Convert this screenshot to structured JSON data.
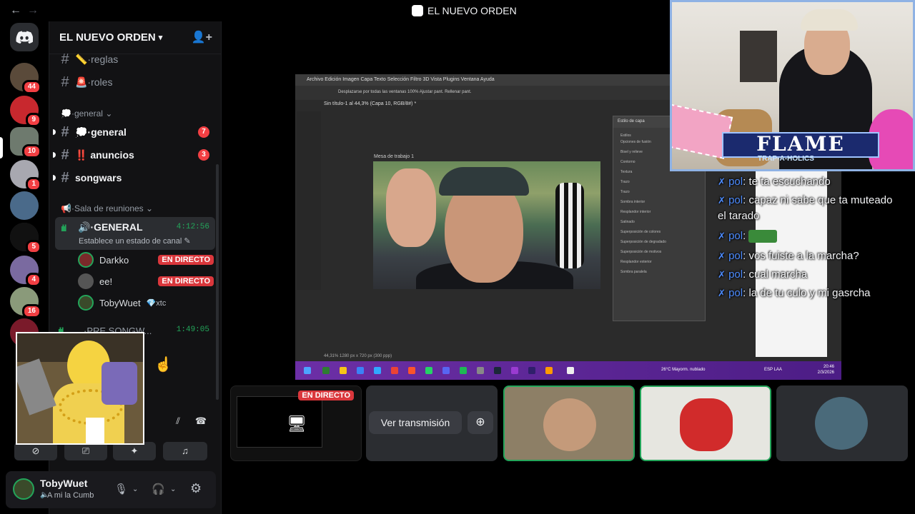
{
  "window": {
    "title": "EL NUEVO ORDEN"
  },
  "server": {
    "name": "EL NUEVO ORDEN"
  },
  "rail": {
    "badges": [
      "44",
      "9",
      "10",
      "1",
      "5",
      "4",
      "16"
    ]
  },
  "channels": {
    "top": [
      {
        "name": "📏·reglas"
      },
      {
        "name": "🚨·roles"
      }
    ],
    "general_category": "💭·general",
    "general": [
      {
        "name": "💭·general",
        "count": "7"
      },
      {
        "name": "‼️ anuncios",
        "count": "3"
      },
      {
        "name": "songwars"
      }
    ],
    "voice_category": "📢·Sala de reuniones",
    "voice_channel": {
      "name": "·GENERAL",
      "time": "4:12:56",
      "status": "Establece un estado de canal"
    },
    "voice_users": [
      {
        "name": "Darkko",
        "live": "EN DIRECTO"
      },
      {
        "name": "ee!",
        "live": "EN DIRECTO"
      },
      {
        "name": "TobyWuet",
        "tag": "💎xtc"
      }
    ],
    "voice2": {
      "name": "·PRE SONGW...",
      "time": "1:49:05"
    }
  },
  "user": {
    "name": "TobyWuet",
    "status": "A mi la Cumb"
  },
  "stream": {
    "ps_menu": "Archivo   Edición   Imagen   Capa   Texto   Selección   Filtro   3D   Vista   Plugins   Ventana   Ayuda",
    "ps_options": "Desplazarse por todas las ventanas      100%      Ajustar pant.      Rellenar pant.",
    "ps_tab": "Sin título-1 al 44,3% (Capa 10, RGB/8#) *",
    "ps_canvas_label": "Mesa de trabajo 1",
    "ps_dialog_title": "Estilo de capa",
    "ps_dialog_rows": [
      "Estilos",
      "Opciones de fusión",
      "Bisel y relieve",
      "Contorno",
      "Textura",
      "Trazo",
      "Trazo",
      "Sombra interior",
      "Resplandor interior",
      "Satinado",
      "Superposición de colores",
      "Superposición de degradado",
      "Superposición de motivos",
      "Resplandor exterior",
      "Sombra paralela"
    ],
    "ps_status": "44,31%      1280 px x 720 px (300 ppp)",
    "clock_time": "20:46",
    "clock_date": "2/3/2026",
    "weather": "26°C Mayorm. nublado",
    "lang": "ESP LAA"
  },
  "chat": [
    {
      "user": "pol",
      "text": ": te ta escuchando"
    },
    {
      "user": "pol",
      "text": ": capaz ni sabe que ta muteado"
    },
    {
      "user": "",
      "text": "el tarado"
    },
    {
      "user": "pol",
      "text": ":"
    },
    {
      "user": "pol",
      "text": ": vos fuiste a la marcha?"
    },
    {
      "user": "pol",
      "text": ": cual marcha"
    },
    {
      "user": "pol",
      "text": ": la de tu culo y mi gasrcha"
    }
  ],
  "webcam": {
    "banner": "FLAME",
    "sub": "TRAP-A-HOLICS"
  },
  "tiles": {
    "live_label": "EN DIRECTO",
    "watch_label": "Ver transmisión"
  },
  "colors": {
    "accent_green": "#23a55a",
    "live_red": "#da373c",
    "chat_user": "#4d8cff"
  }
}
